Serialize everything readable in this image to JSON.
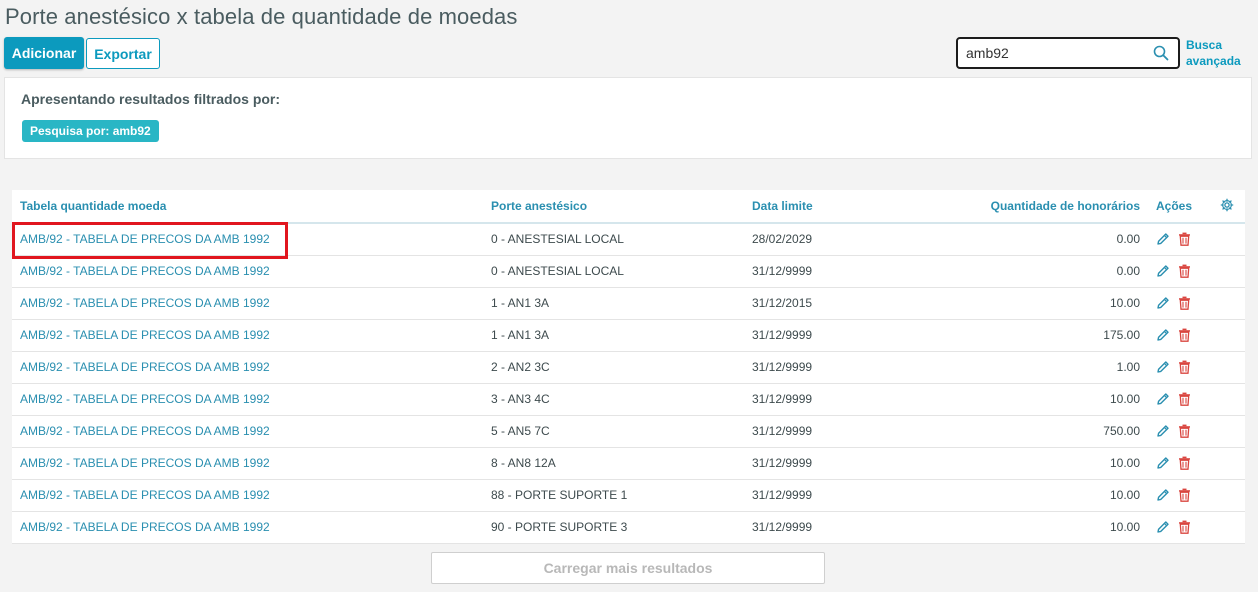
{
  "page": {
    "title": "Porte anestésico x tabela de quantidade de moedas"
  },
  "toolbar": {
    "add_label": "Adicionar",
    "export_label": "Exportar"
  },
  "search": {
    "value": "amb92",
    "advanced_line1": "Busca",
    "advanced_line2": "avançada"
  },
  "filter": {
    "title": "Apresentando resultados filtrados por:",
    "tag": "Pesquisa por: amb92"
  },
  "table": {
    "headers": {
      "col1": "Tabela quantidade moeda",
      "col2": "Porte anestésico",
      "col3": "Data limite",
      "col4": "Quantidade de honorários",
      "col5": "Ações"
    },
    "rows": [
      {
        "tabela": "AMB/92 - TABELA DE PRECOS DA AMB 1992",
        "porte": "0 - ANESTESIAL LOCAL",
        "data": "28/02/2029",
        "qtd": "0.00"
      },
      {
        "tabela": "AMB/92 - TABELA DE PRECOS DA AMB 1992",
        "porte": "0 - ANESTESIAL LOCAL",
        "data": "31/12/9999",
        "qtd": "0.00"
      },
      {
        "tabela": "AMB/92 - TABELA DE PRECOS DA AMB 1992",
        "porte": "1 - AN1 3A",
        "data": "31/12/2015",
        "qtd": "10.00"
      },
      {
        "tabela": "AMB/92 - TABELA DE PRECOS DA AMB 1992",
        "porte": "1 - AN1 3A",
        "data": "31/12/9999",
        "qtd": "175.00"
      },
      {
        "tabela": "AMB/92 - TABELA DE PRECOS DA AMB 1992",
        "porte": "2 - AN2 3C",
        "data": "31/12/9999",
        "qtd": "1.00"
      },
      {
        "tabela": "AMB/92 - TABELA DE PRECOS DA AMB 1992",
        "porte": "3 - AN3 4C",
        "data": "31/12/9999",
        "qtd": "10.00"
      },
      {
        "tabela": "AMB/92 - TABELA DE PRECOS DA AMB 1992",
        "porte": "5 - AN5 7C",
        "data": "31/12/9999",
        "qtd": "750.00"
      },
      {
        "tabela": "AMB/92 - TABELA DE PRECOS DA AMB 1992",
        "porte": "8 - AN8 12A",
        "data": "31/12/9999",
        "qtd": "10.00"
      },
      {
        "tabela": "AMB/92 - TABELA DE PRECOS DA AMB 1992",
        "porte": "88 - PORTE SUPORTE 1",
        "data": "31/12/9999",
        "qtd": "10.00"
      },
      {
        "tabela": "AMB/92 - TABELA DE PRECOS DA AMB 1992",
        "porte": "90 - PORTE SUPORTE 3",
        "data": "31/12/9999",
        "qtd": "10.00"
      }
    ]
  },
  "load_more": "Carregar mais resultados",
  "icons": {
    "search": "search-icon",
    "gear": "gear-icon",
    "edit": "pencil-icon",
    "delete": "trash-icon"
  },
  "colors": {
    "primary": "#0c9abe",
    "link": "#2a8fb0",
    "tag": "#29b6c5",
    "delete": "#d9453f",
    "highlight": "#e1161f"
  }
}
